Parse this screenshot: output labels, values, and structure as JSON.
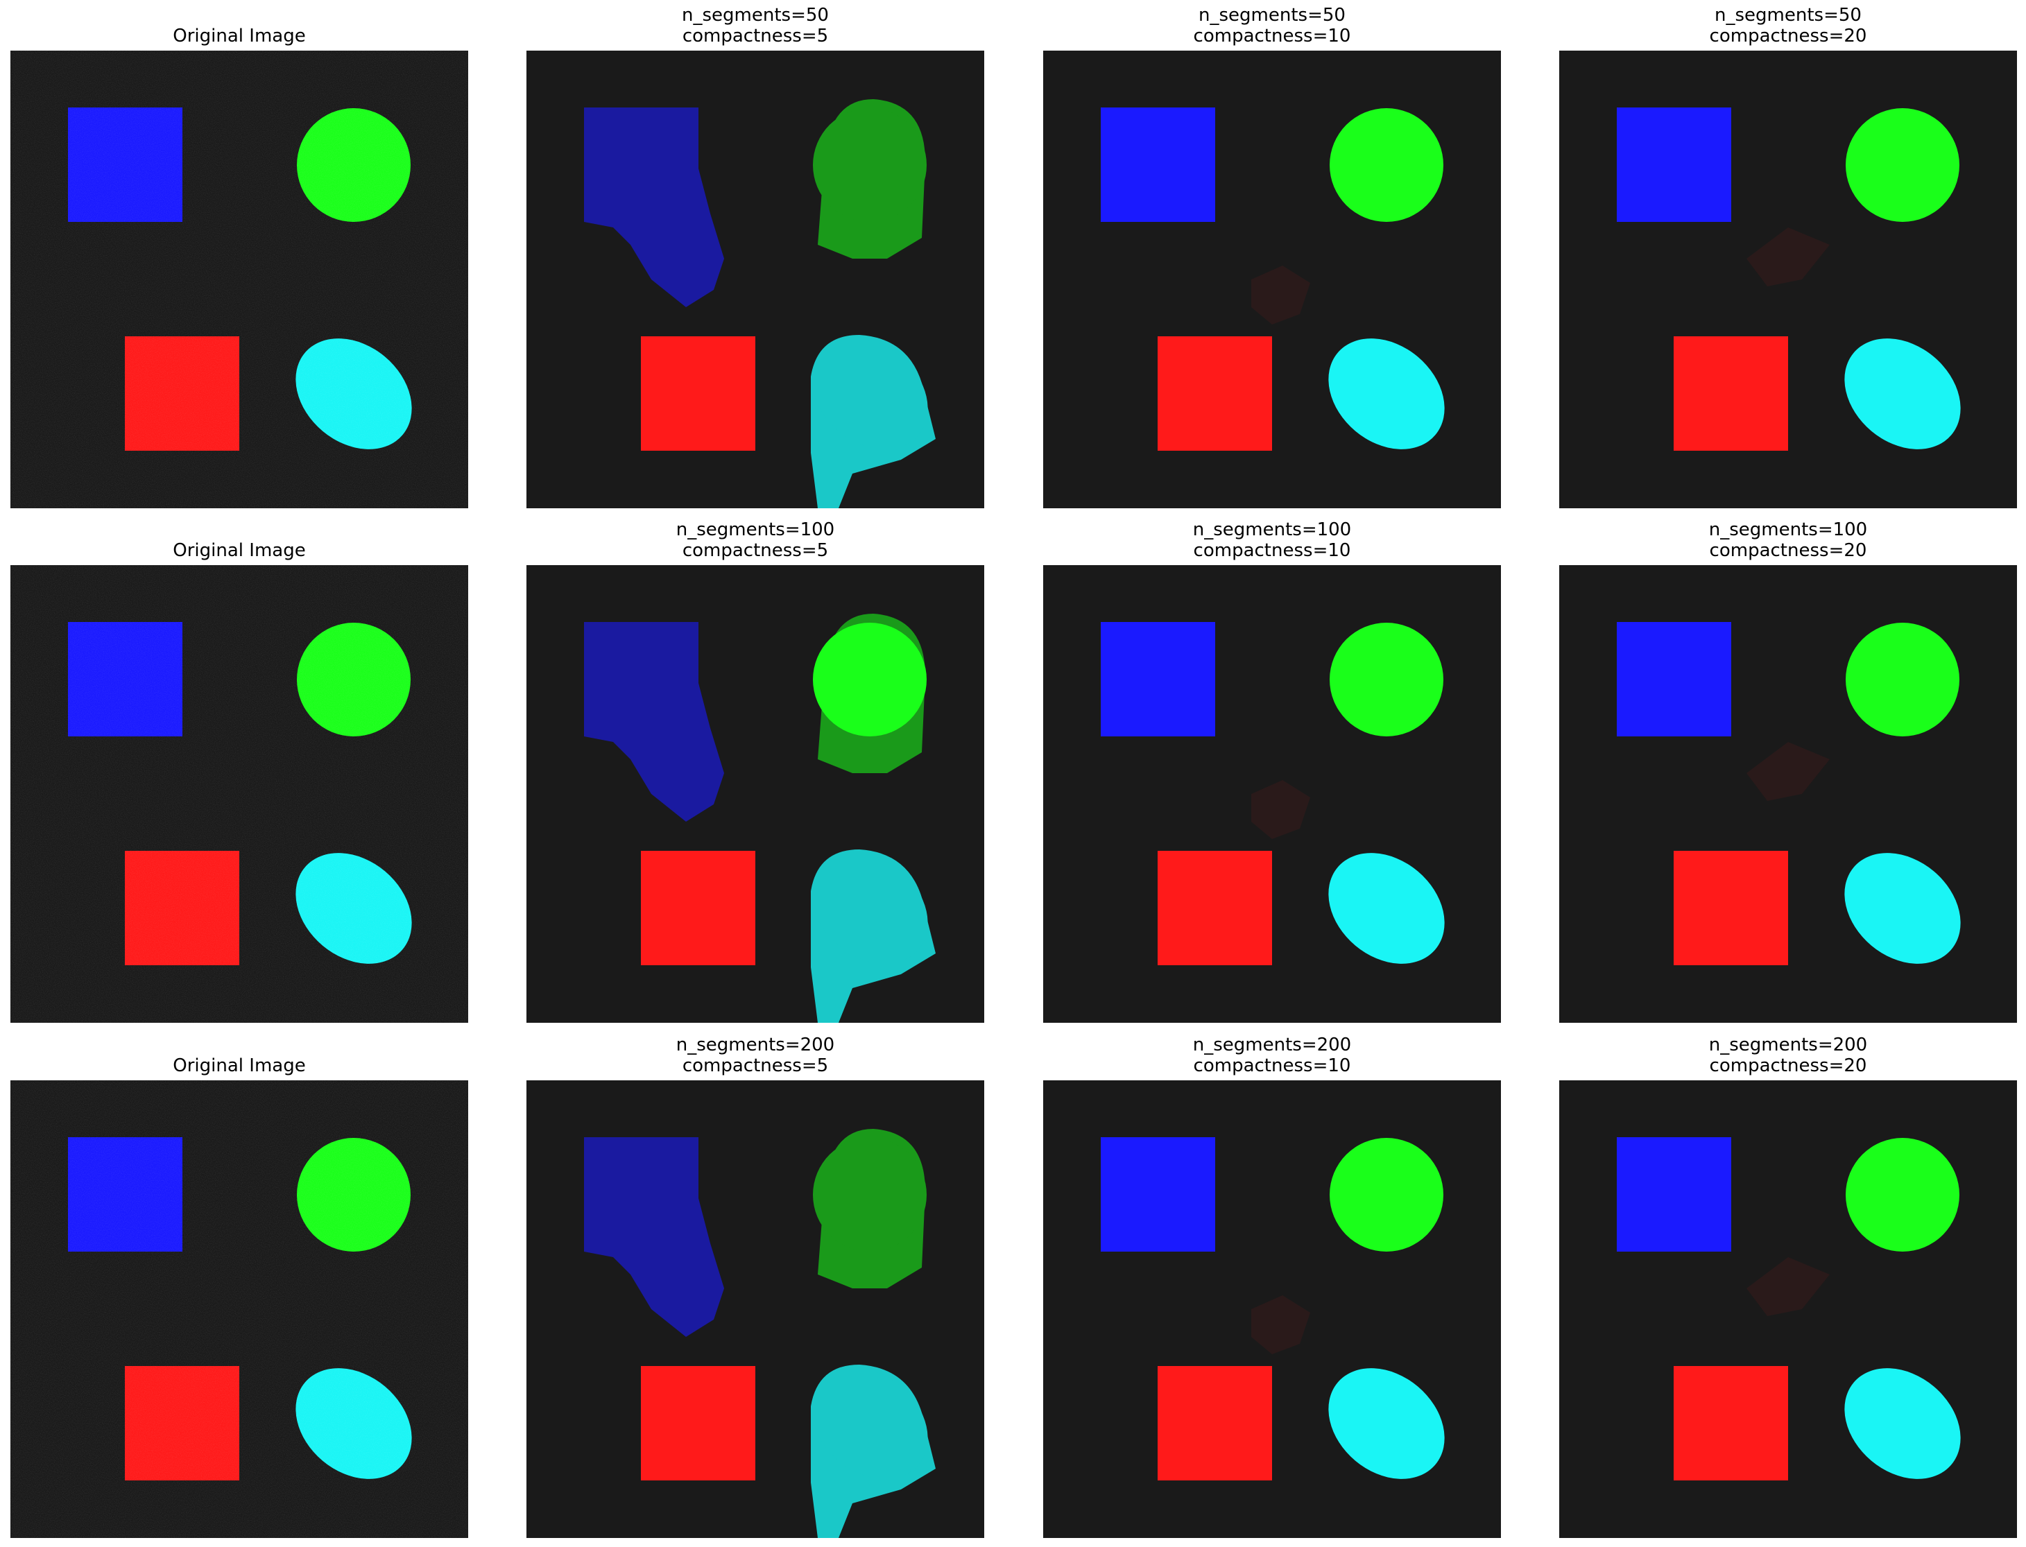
{
  "figure": {
    "rows": [
      {
        "panels": [
          {
            "title_lines": [
              "Original Image"
            ],
            "kind": "original"
          },
          {
            "title_lines": [
              "n_segments=50",
              "compactness=5"
            ],
            "kind": "seg",
            "n_segments": 50,
            "compactness": 5
          },
          {
            "title_lines": [
              "n_segments=50",
              "compactness=10"
            ],
            "kind": "seg",
            "n_segments": 50,
            "compactness": 10
          },
          {
            "title_lines": [
              "n_segments=50",
              "compactness=20"
            ],
            "kind": "seg",
            "n_segments": 50,
            "compactness": 20
          }
        ]
      },
      {
        "panels": [
          {
            "title_lines": [
              "Original Image"
            ],
            "kind": "original"
          },
          {
            "title_lines": [
              "n_segments=100",
              "compactness=5"
            ],
            "kind": "seg",
            "n_segments": 100,
            "compactness": 5
          },
          {
            "title_lines": [
              "n_segments=100",
              "compactness=10"
            ],
            "kind": "seg",
            "n_segments": 100,
            "compactness": 10
          },
          {
            "title_lines": [
              "n_segments=100",
              "compactness=20"
            ],
            "kind": "seg",
            "n_segments": 100,
            "compactness": 20
          }
        ]
      },
      {
        "panels": [
          {
            "title_lines": [
              "Original Image"
            ],
            "kind": "original"
          },
          {
            "title_lines": [
              "n_segments=200",
              "compactness=5"
            ],
            "kind": "seg",
            "n_segments": 200,
            "compactness": 5
          },
          {
            "title_lines": [
              "n_segments=200",
              "compactness=10"
            ],
            "kind": "seg",
            "n_segments": 200,
            "compactness": 10
          },
          {
            "title_lines": [
              "n_segments=200",
              "compactness=20"
            ],
            "kind": "seg",
            "n_segments": 200,
            "compactness": 20
          }
        ]
      }
    ],
    "colors": {
      "background": "#1a1a1a",
      "blue_square": "#1a1aff",
      "green_circle": "#1aff1a",
      "red_square": "#ff1a1a",
      "cyan_ellipse": "#1af5f5"
    }
  }
}
